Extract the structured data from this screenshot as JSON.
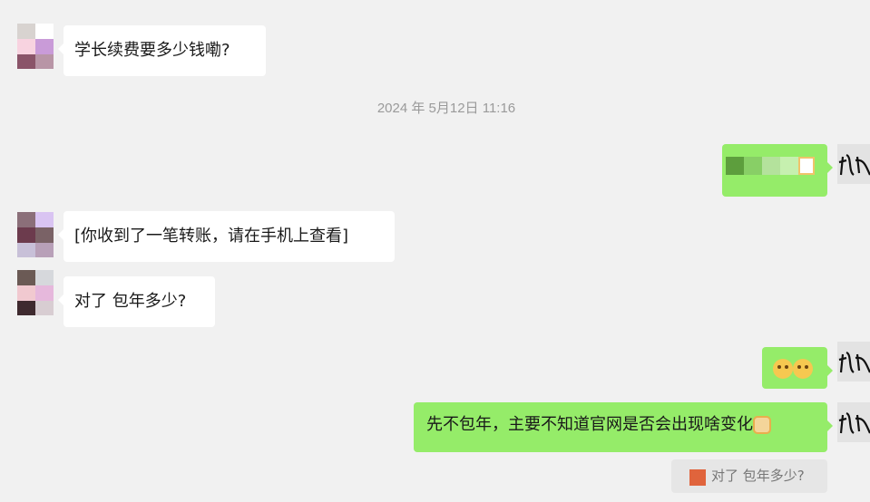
{
  "messages": {
    "m1_text": "学长续费要多少钱嘞?",
    "timestamp": "2024 年 5月12日 11:16",
    "m3_text": "[你收到了一笔转账，请在手机上查看]",
    "m4_text": "对了 包年多少?",
    "m5_emoji_names": [
      "666-emoji-icon",
      "666-emoji-icon"
    ],
    "m6_text": "先不包年，主要不知道官网是否会出现啥变化",
    "quote_text": "对了 包年多少?"
  },
  "colors": {
    "background": "#f1f1f1",
    "incoming_bubble": "#ffffff",
    "outgoing_bubble": "#95ec69",
    "timestamp_text": "#9a9a9a"
  }
}
